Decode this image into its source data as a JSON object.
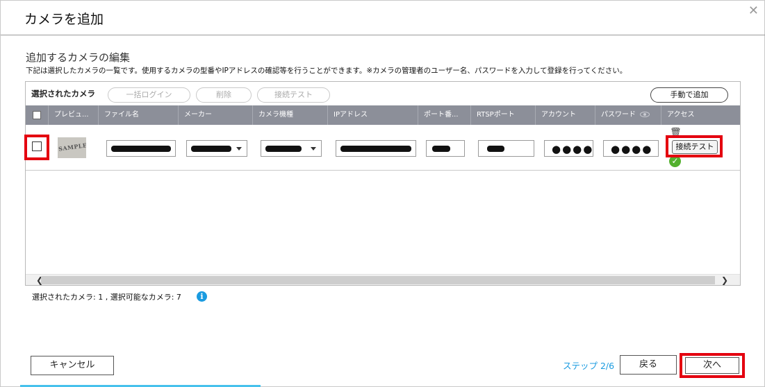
{
  "dialog": {
    "title": "カメラを追加",
    "close_icon": "close-icon"
  },
  "section": {
    "title": "追加するカメラの編集",
    "description": "下記は選択したカメラの一覧です。使用するカメラの型番やIPアドレスの確認等を行うことができます。※カメラの管理者のユーザー名、パスワードを入力して登録を行ってください。"
  },
  "toolbar": {
    "title": "選択されたカメラ",
    "bulk_login": "一括ログイン",
    "delete": "削除",
    "connection_test": "接続テスト",
    "manual_add": "手動で追加"
  },
  "table": {
    "columns": [
      "プレビュ...",
      "ファイル名",
      "メーカー",
      "カメラ機種",
      "IPアドレス",
      "ポート番...",
      "RTSPポート",
      "アカウント",
      "パスワード",
      "アクセス"
    ],
    "rows": [
      {
        "preview_text": "SAMPLE",
        "account": "●●●●",
        "password": "●●●●",
        "connection_test": "接続テスト"
      }
    ]
  },
  "status": {
    "text": "選択されたカメラ:   1    , 選択可能なカメラ:   7"
  },
  "footer": {
    "cancel": "キャンセル",
    "step": "ステップ 2/6",
    "back": "戻る",
    "next": "次へ"
  },
  "colors": {
    "accent": "#1a9be0",
    "highlight": "#e4000f",
    "header": "#8c8f99",
    "success": "#53b02e"
  }
}
